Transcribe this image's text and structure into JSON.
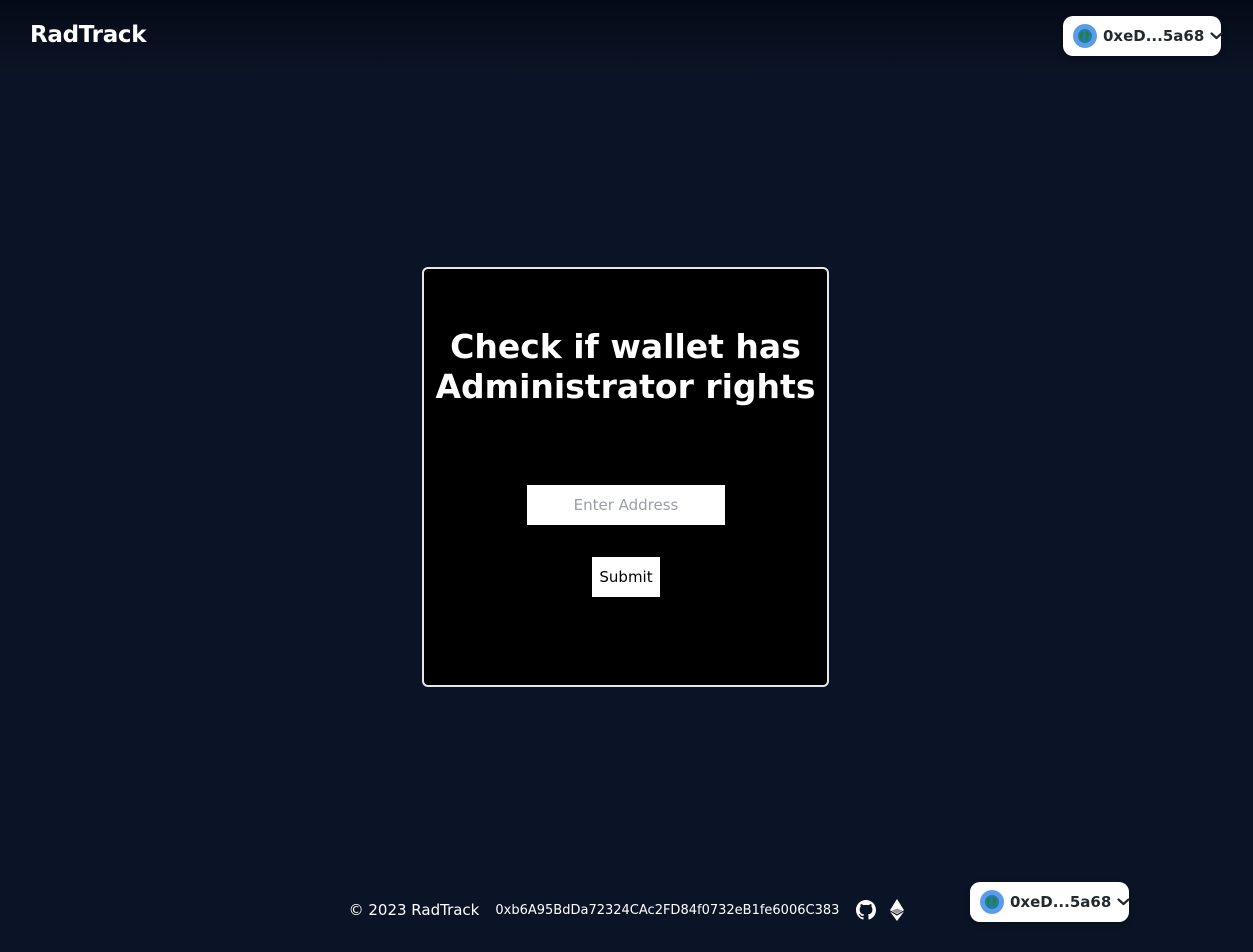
{
  "header": {
    "brand": "RadTrack",
    "wallet": {
      "address": "0xeD...5a68",
      "avatar_icon": "globe-icon",
      "dropdown_icon": "chevron-down-icon"
    }
  },
  "card": {
    "title": "Check if wallet has Administrator rights",
    "address_input": {
      "value": "",
      "placeholder": "Enter Address"
    },
    "submit_label": "Submit",
    "wallet": {
      "address": "0xeD...5a68",
      "avatar_icon": "globe-icon",
      "dropdown_icon": "chevron-down-icon"
    }
  },
  "footer": {
    "copyright": "© 2023 RadTrack",
    "contract_address": "0xb6A95BdDa72324CAc2FD84f0732eB1fe6006C383",
    "icons": [
      "github-icon",
      "ethereum-icon"
    ]
  },
  "colors": {
    "background": "#0b1426",
    "card_background": "#000000",
    "card_border": "#e6e6e6",
    "avatar": "#5b9be8",
    "text": "#ffffff"
  }
}
